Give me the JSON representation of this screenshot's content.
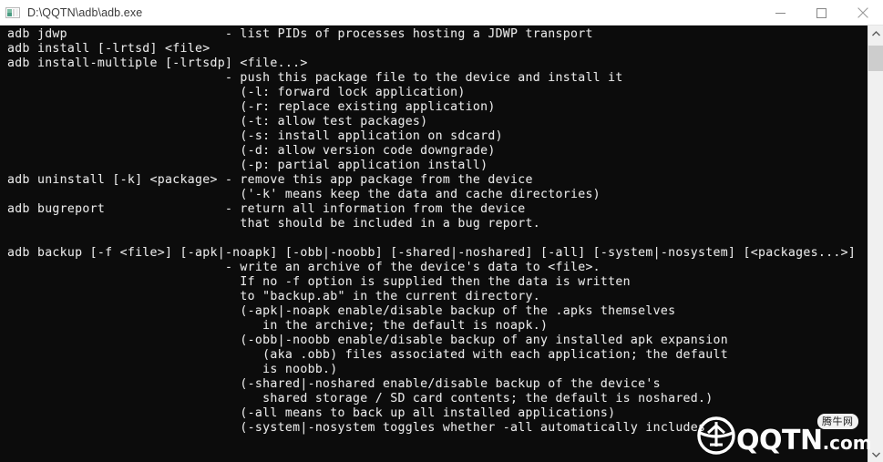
{
  "window": {
    "title": "D:\\QQTN\\adb\\adb.exe",
    "icon": "console-app-icon",
    "background_color": "#0c0c0c",
    "titlebar_color": "#ffffff",
    "text_color": "#e8e8e8",
    "controls": {
      "minimize_label": "Minimize",
      "minimize_icon": "minimize-icon",
      "maximize_label": "Maximize",
      "maximize_icon": "maximize-icon",
      "close_label": "Close",
      "close_icon": "close-icon"
    }
  },
  "scrollbar": {
    "up_arrow_icon": "chevron-up-icon",
    "down_arrow_icon": "chevron-down-icon",
    "thumb_name": "scrollbar-thumb",
    "thumb_color": "#cdcdcd",
    "track_color": "#f0f0f0"
  },
  "watermark": {
    "site": "QQTN",
    "tld": ".com",
    "badge": "腾牛网",
    "globe_icon": "qqtn-globe-logo"
  },
  "console": {
    "lines": [
      "adb jdwp                     - list PIDs of processes hosting a JDWP transport",
      "adb install [-lrtsd] <file>",
      "adb install-multiple [-lrtsdp] <file...>",
      "                             - push this package file to the device and install it",
      "                               (-l: forward lock application)",
      "                               (-r: replace existing application)",
      "                               (-t: allow test packages)",
      "                               (-s: install application on sdcard)",
      "                               (-d: allow version code downgrade)",
      "                               (-p: partial application install)",
      "adb uninstall [-k] <package> - remove this app package from the device",
      "                               ('-k' means keep the data and cache directories)",
      "adb bugreport                - return all information from the device",
      "                               that should be included in a bug report.",
      "",
      "adb backup [-f <file>] [-apk|-noapk] [-obb|-noobb] [-shared|-noshared] [-all] [-system|-nosystem] [<packages...>]",
      "                             - write an archive of the device's data to <file>.",
      "                               If no -f option is supplied then the data is written",
      "                               to \"backup.ab\" in the current directory.",
      "                               (-apk|-noapk enable/disable backup of the .apks themselves",
      "                                  in the archive; the default is noapk.)",
      "                               (-obb|-noobb enable/disable backup of any installed apk expansion",
      "                                  (aka .obb) files associated with each application; the default",
      "                                  is noobb.)",
      "                               (-shared|-noshared enable/disable backup of the device's",
      "                                  shared storage / SD card contents; the default is noshared.)",
      "                               (-all means to back up all installed applications)",
      "                               (-system|-nosystem toggles whether -all automatically includes"
    ]
  }
}
